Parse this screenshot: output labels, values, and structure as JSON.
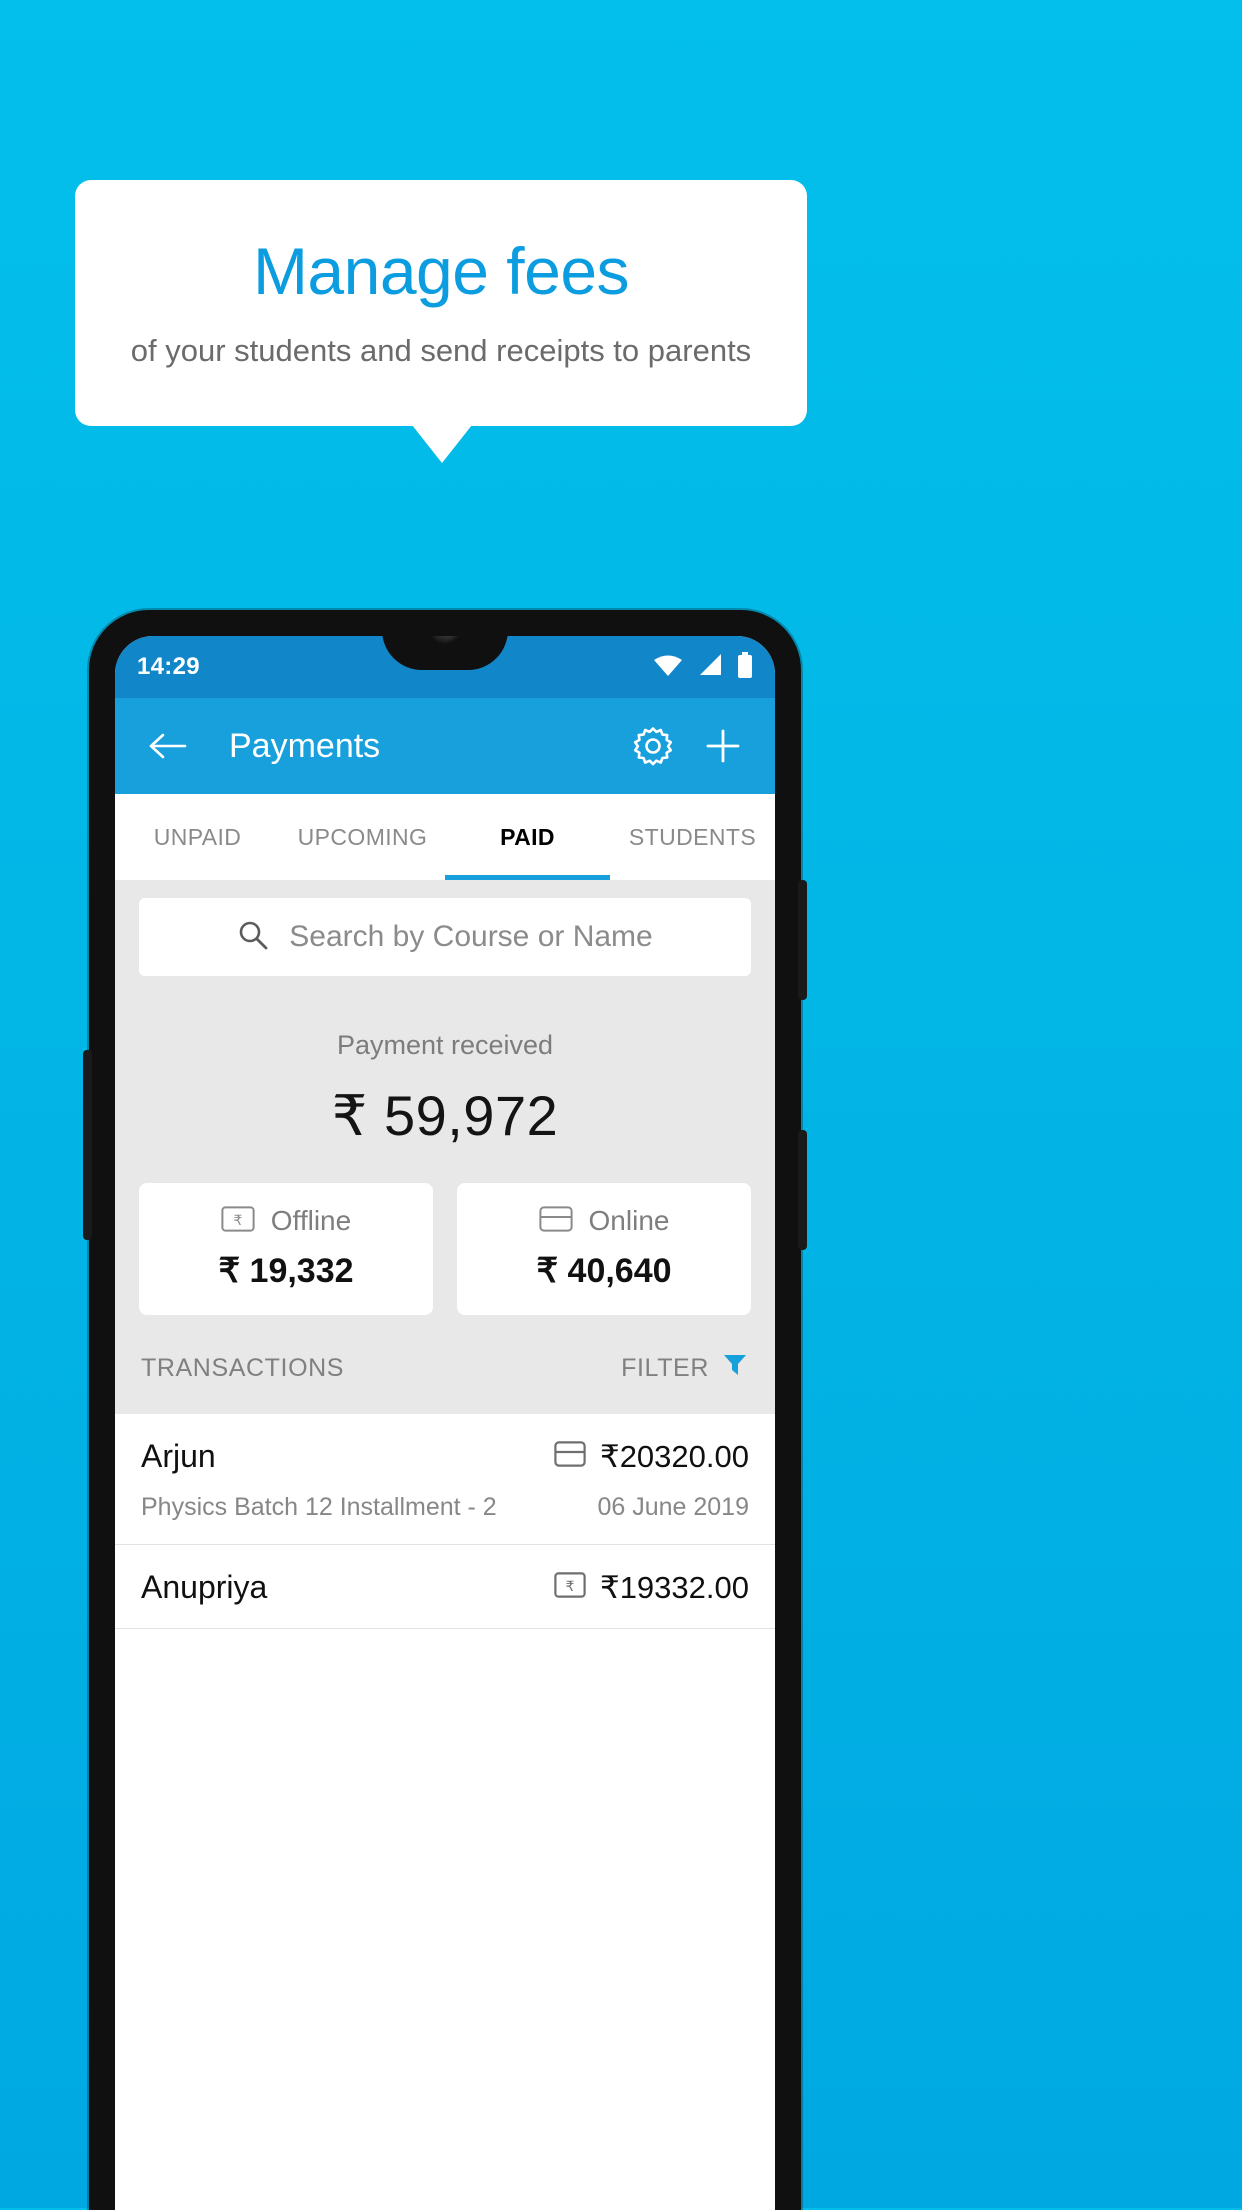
{
  "promo": {
    "title": "Manage fees",
    "subtitle": "of your students and send receipts to parents"
  },
  "colors": {
    "background_top": "#03BFEB",
    "background_bottom": "#00A8E2",
    "accent": "#18A0DC",
    "promo_title": "#0B9DE0",
    "status_bar": "#1186C8"
  },
  "phone": {
    "status_bar": {
      "time": "14:29",
      "icons": [
        "wifi-icon",
        "signal-icon",
        "battery-icon"
      ]
    },
    "app_bar": {
      "back_icon": "arrow-left-icon",
      "title": "Payments",
      "settings_icon": "gear-icon",
      "add_icon": "plus-icon"
    },
    "tabs": [
      {
        "label": "UNPAID",
        "active": false
      },
      {
        "label": "UPCOMING",
        "active": false
      },
      {
        "label": "PAID",
        "active": true
      },
      {
        "label": "STUDENTS",
        "active": false
      }
    ],
    "search": {
      "icon": "search-icon",
      "placeholder": "Search by Course or Name",
      "value": ""
    },
    "summary": {
      "label": "Payment received",
      "amount": "₹ 59,972"
    },
    "modes": [
      {
        "icon": "rupee-note-icon",
        "label": "Offline",
        "amount": "₹ 19,332"
      },
      {
        "icon": "credit-card-icon",
        "label": "Online",
        "amount": "₹ 40,640"
      }
    ],
    "transactions_header": {
      "title": "TRANSACTIONS",
      "filter_label": "FILTER",
      "filter_icon": "funnel-icon"
    },
    "transactions": [
      {
        "name": "Arjun",
        "icon": "credit-card-icon",
        "amount": "₹20320.00",
        "description": "Physics Batch 12 Installment - 2",
        "date": "06 June 2019"
      },
      {
        "name": "Anupriya",
        "icon": "rupee-note-icon",
        "amount": "₹19332.00",
        "description": "",
        "date": ""
      }
    ]
  }
}
